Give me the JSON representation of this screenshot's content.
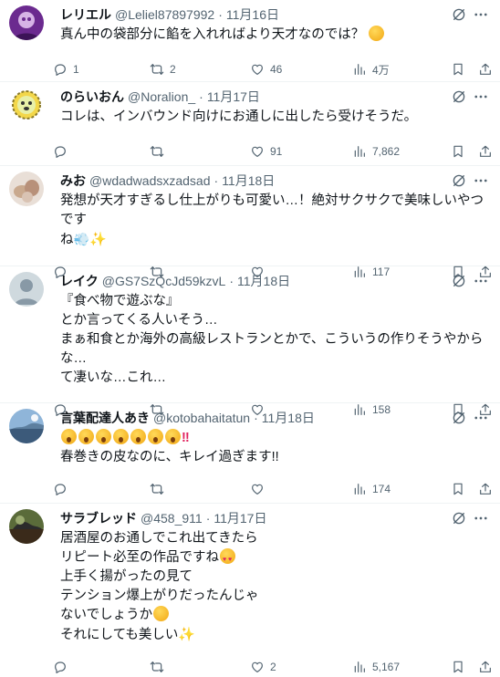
{
  "colors": {
    "text": "#0f1419",
    "muted": "#536471",
    "divider": "#eff3f4"
  },
  "icons": {
    "reply": "reply-icon",
    "retweet": "retweet-icon",
    "like": "heart-icon",
    "views": "views-chart-icon",
    "bookmark": "bookmark-icon",
    "share": "share-icon",
    "grok": "grok-icon",
    "more": "more-icon"
  },
  "tweets": [
    {
      "name": "レリエル",
      "handle": "@Leliel87897992",
      "date": "11月16日",
      "text": "真ん中の袋部分に餡を入れればより天才なのでは？",
      "emoji_tail": "think",
      "replies": "1",
      "retweets": "2",
      "likes": "46",
      "views": "4万"
    },
    {
      "name": "のらいおん",
      "handle": "@Noralion_",
      "date": "11月17日",
      "text": "コレは、インバウンド向けにお通しに出したら受けそうだ。",
      "replies": "",
      "retweets": "",
      "likes": "91",
      "views": "7,862"
    },
    {
      "name": "みお",
      "handle": "@wdadwadsxzadsad",
      "date": "11月18日",
      "text": "発想が天才すぎるし仕上がりも可愛い…！絶対サクサクで美味しいやつです\nね",
      "replies": "",
      "retweets": "",
      "likes": "",
      "views": "117"
    },
    {
      "name": "レイク",
      "handle": "@GS7SzQcJd59kzvL",
      "date": "11月18日",
      "text": "『食べ物で遊ぶな』\nとか言ってくる人いそう…\nまぁ和食とか海外の高級レストランとかで、こういうの作りそうやからな…\nて凄いな…これ…",
      "replies": "",
      "retweets": "",
      "likes": "",
      "views": "158"
    },
    {
      "name": "言葉配達人あき",
      "handle": "@kotobahaitatun",
      "date": "11月18日",
      "text2": "春巻きの皮なのに、キレイ過ぎます!!",
      "replies": "",
      "retweets": "",
      "likes": "",
      "views": "174"
    },
    {
      "name": "サラブレッド",
      "handle": "@458_911",
      "date": "11月17日",
      "line1": "居酒屋のお通しでこれ出てきたら",
      "line2": "リピート必至の作品ですね",
      "line3": "上手く揚がったの見て\nテンション爆上がりだったんじゃ",
      "line4": "ないでしょうか",
      "line5": "それにしても美しい",
      "replies": "",
      "retweets": "",
      "likes": "2",
      "views": "5,167"
    }
  ]
}
